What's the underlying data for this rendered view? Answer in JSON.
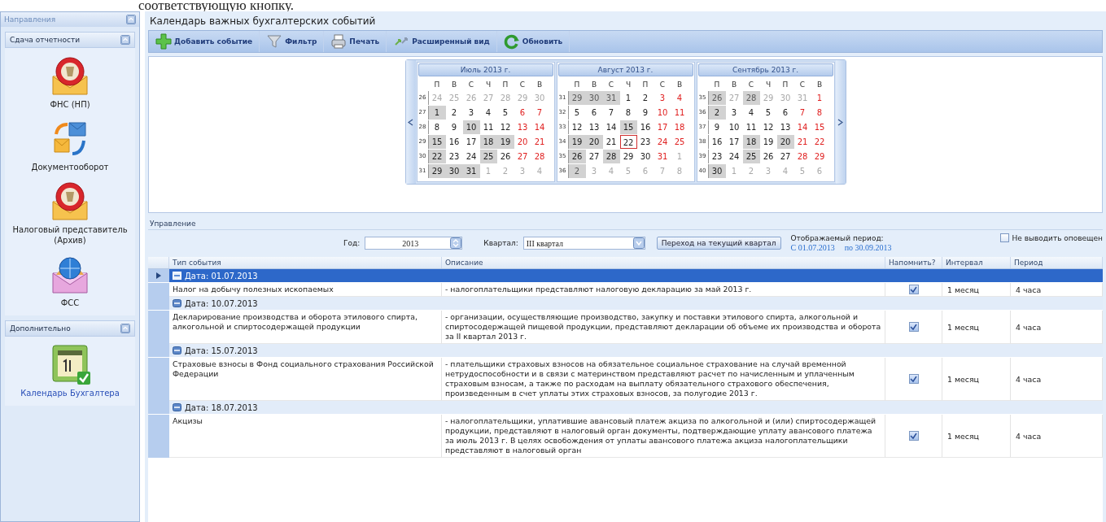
{
  "document_text": "соответствующую кнопку.",
  "sidebar": {
    "title": "Направления",
    "sections": [
      {
        "title": "Сдача отчетности",
        "items": [
          {
            "label": "ФНС (НП)",
            "kind": "tax",
            "selected": false
          },
          {
            "label": "Документооборот",
            "kind": "exchange",
            "selected": false
          },
          {
            "label": "Налоговый представитель (Архив)",
            "kind": "tax",
            "selected": false
          },
          {
            "label": "ФСС",
            "kind": "fss",
            "selected": false
          }
        ]
      },
      {
        "title": "Дополнительно",
        "items": [
          {
            "label": "Календарь Бухгалтера",
            "kind": "calendar",
            "selected": true
          }
        ]
      }
    ]
  },
  "page_title": "Календарь важных бухгалтерских событий",
  "toolbar": [
    {
      "label": "Добавить событие",
      "kind": "add"
    },
    {
      "label": "Фильтр",
      "kind": "filter"
    },
    {
      "label": "Печать",
      "kind": "print"
    },
    {
      "label": "Расширенный вид",
      "kind": "extended"
    },
    {
      "label": "Обновить",
      "kind": "refresh"
    }
  ],
  "calendars": [
    {
      "title": "Июль 2013 г.",
      "weekdays": [
        "П",
        "В",
        "С",
        "Ч",
        "П",
        "С",
        "В"
      ],
      "weeks": [
        {
          "number": "26",
          "days": [
            {
              "text": "24",
              "kind": "outside",
              "marked": false,
              "today": false
            },
            {
              "text": "25",
              "kind": "outside",
              "marked": false,
              "today": false
            },
            {
              "text": "26",
              "kind": "outside",
              "marked": false,
              "today": false
            },
            {
              "text": "27",
              "kind": "outside",
              "marked": false,
              "today": false
            },
            {
              "text": "28",
              "kind": "outside",
              "marked": false,
              "today": false
            },
            {
              "text": "29",
              "kind": "outside",
              "marked": false,
              "today": false
            },
            {
              "text": "30",
              "kind": "outside",
              "marked": false,
              "today": false
            }
          ]
        },
        {
          "number": "27",
          "days": [
            {
              "text": "1",
              "kind": "workday",
              "marked": true,
              "today": false
            },
            {
              "text": "2",
              "kind": "workday",
              "marked": false,
              "today": false
            },
            {
              "text": "3",
              "kind": "workday",
              "marked": false,
              "today": false
            },
            {
              "text": "4",
              "kind": "workday",
              "marked": false,
              "today": false
            },
            {
              "text": "5",
              "kind": "workday",
              "marked": false,
              "today": false
            },
            {
              "text": "6",
              "kind": "weekend",
              "marked": false,
              "today": false
            },
            {
              "text": "7",
              "kind": "weekend",
              "marked": false,
              "today": false
            }
          ]
        },
        {
          "number": "28",
          "days": [
            {
              "text": "8",
              "kind": "workday",
              "marked": false,
              "today": false
            },
            {
              "text": "9",
              "kind": "workday",
              "marked": false,
              "today": false
            },
            {
              "text": "10",
              "kind": "workday",
              "marked": true,
              "today": false
            },
            {
              "text": "11",
              "kind": "workday",
              "marked": false,
              "today": false
            },
            {
              "text": "12",
              "kind": "workday",
              "marked": false,
              "today": false
            },
            {
              "text": "13",
              "kind": "weekend",
              "marked": false,
              "today": false
            },
            {
              "text": "14",
              "kind": "weekend",
              "marked": false,
              "today": false
            }
          ]
        },
        {
          "number": "29",
          "days": [
            {
              "text": "15",
              "kind": "workday",
              "marked": true,
              "today": false
            },
            {
              "text": "16",
              "kind": "workday",
              "marked": false,
              "today": false
            },
            {
              "text": "17",
              "kind": "workday",
              "marked": false,
              "today": false
            },
            {
              "text": "18",
              "kind": "workday",
              "marked": true,
              "today": false
            },
            {
              "text": "19",
              "kind": "workday",
              "marked": true,
              "today": false
            },
            {
              "text": "20",
              "kind": "weekend",
              "marked": false,
              "today": false
            },
            {
              "text": "21",
              "kind": "weekend",
              "marked": false,
              "today": false
            }
          ]
        },
        {
          "number": "30",
          "days": [
            {
              "text": "22",
              "kind": "workday",
              "marked": true,
              "today": false
            },
            {
              "text": "23",
              "kind": "workday",
              "marked": false,
              "today": false
            },
            {
              "text": "24",
              "kind": "workday",
              "marked": false,
              "today": false
            },
            {
              "text": "25",
              "kind": "workday",
              "marked": true,
              "today": false
            },
            {
              "text": "26",
              "kind": "workday",
              "marked": false,
              "today": false
            },
            {
              "text": "27",
              "kind": "weekend",
              "marked": false,
              "today": false
            },
            {
              "text": "28",
              "kind": "weekend",
              "marked": false,
              "today": false
            }
          ]
        },
        {
          "number": "31",
          "days": [
            {
              "text": "29",
              "kind": "workday",
              "marked": true,
              "today": false
            },
            {
              "text": "30",
              "kind": "workday",
              "marked": true,
              "today": false
            },
            {
              "text": "31",
              "kind": "workday",
              "marked": true,
              "today": false
            },
            {
              "text": "1",
              "kind": "outside",
              "marked": false,
              "today": false
            },
            {
              "text": "2",
              "kind": "outside",
              "marked": false,
              "today": false
            },
            {
              "text": "3",
              "kind": "outside",
              "marked": false,
              "today": false
            },
            {
              "text": "4",
              "kind": "outside",
              "marked": false,
              "today": false
            }
          ]
        }
      ]
    },
    {
      "title": "Август 2013 г.",
      "weekdays": [
        "П",
        "В",
        "С",
        "Ч",
        "П",
        "С",
        "В"
      ],
      "weeks": [
        {
          "number": "31",
          "days": [
            {
              "text": "29",
              "kind": "outside",
              "marked": true,
              "today": false
            },
            {
              "text": "30",
              "kind": "outside",
              "marked": true,
              "today": false
            },
            {
              "text": "31",
              "kind": "outside",
              "marked": true,
              "today": false
            },
            {
              "text": "1",
              "kind": "workday",
              "marked": false,
              "today": false
            },
            {
              "text": "2",
              "kind": "workday",
              "marked": false,
              "today": false
            },
            {
              "text": "3",
              "kind": "weekend",
              "marked": false,
              "today": false
            },
            {
              "text": "4",
              "kind": "weekend",
              "marked": false,
              "today": false
            }
          ]
        },
        {
          "number": "32",
          "days": [
            {
              "text": "5",
              "kind": "workday",
              "marked": false,
              "today": false
            },
            {
              "text": "6",
              "kind": "workday",
              "marked": false,
              "today": false
            },
            {
              "text": "7",
              "kind": "workday",
              "marked": false,
              "today": false
            },
            {
              "text": "8",
              "kind": "workday",
              "marked": false,
              "today": false
            },
            {
              "text": "9",
              "kind": "workday",
              "marked": false,
              "today": false
            },
            {
              "text": "10",
              "kind": "weekend",
              "marked": false,
              "today": false
            },
            {
              "text": "11",
              "kind": "weekend",
              "marked": false,
              "today": false
            }
          ]
        },
        {
          "number": "33",
          "days": [
            {
              "text": "12",
              "kind": "workday",
              "marked": false,
              "today": false
            },
            {
              "text": "13",
              "kind": "workday",
              "marked": false,
              "today": false
            },
            {
              "text": "14",
              "kind": "workday",
              "marked": false,
              "today": false
            },
            {
              "text": "15",
              "kind": "workday",
              "marked": true,
              "today": false
            },
            {
              "text": "16",
              "kind": "workday",
              "marked": false,
              "today": false
            },
            {
              "text": "17",
              "kind": "weekend",
              "marked": false,
              "today": false
            },
            {
              "text": "18",
              "kind": "weekend",
              "marked": false,
              "today": false
            }
          ]
        },
        {
          "number": "34",
          "days": [
            {
              "text": "19",
              "kind": "workday",
              "marked": true,
              "today": false
            },
            {
              "text": "20",
              "kind": "workday",
              "marked": true,
              "today": false
            },
            {
              "text": "21",
              "kind": "workday",
              "marked": false,
              "today": false
            },
            {
              "text": "22",
              "kind": "workday",
              "marked": false,
              "today": true
            },
            {
              "text": "23",
              "kind": "workday",
              "marked": false,
              "today": false
            },
            {
              "text": "24",
              "kind": "weekend",
              "marked": false,
              "today": false
            },
            {
              "text": "25",
              "kind": "weekend",
              "marked": false,
              "today": false
            }
          ]
        },
        {
          "number": "35",
          "days": [
            {
              "text": "26",
              "kind": "workday",
              "marked": true,
              "today": false
            },
            {
              "text": "27",
              "kind": "workday",
              "marked": false,
              "today": false
            },
            {
              "text": "28",
              "kind": "workday",
              "marked": true,
              "today": false
            },
            {
              "text": "29",
              "kind": "workday",
              "marked": false,
              "today": false
            },
            {
              "text": "30",
              "kind": "workday",
              "marked": false,
              "today": false
            },
            {
              "text": "31",
              "kind": "weekend",
              "marked": false,
              "today": false
            },
            {
              "text": "1",
              "kind": "outside",
              "marked": false,
              "today": false
            }
          ]
        },
        {
          "number": "36",
          "days": [
            {
              "text": "2",
              "kind": "outside",
              "marked": true,
              "today": false
            },
            {
              "text": "3",
              "kind": "outside",
              "marked": false,
              "today": false
            },
            {
              "text": "4",
              "kind": "outside",
              "marked": false,
              "today": false
            },
            {
              "text": "5",
              "kind": "outside",
              "marked": false,
              "today": false
            },
            {
              "text": "6",
              "kind": "outside",
              "marked": false,
              "today": false
            },
            {
              "text": "7",
              "kind": "outside",
              "marked": false,
              "today": false
            },
            {
              "text": "8",
              "kind": "outside",
              "marked": false,
              "today": false
            }
          ]
        }
      ]
    },
    {
      "title": "Сентябрь 2013 г.",
      "weekdays": [
        "П",
        "В",
        "С",
        "Ч",
        "П",
        "С",
        "В"
      ],
      "weeks": [
        {
          "number": "35",
          "days": [
            {
              "text": "26",
              "kind": "outside",
              "marked": true,
              "today": false
            },
            {
              "text": "27",
              "kind": "outside",
              "marked": false,
              "today": false
            },
            {
              "text": "28",
              "kind": "outside",
              "marked": true,
              "today": false
            },
            {
              "text": "29",
              "kind": "outside",
              "marked": false,
              "today": false
            },
            {
              "text": "30",
              "kind": "outside",
              "marked": false,
              "today": false
            },
            {
              "text": "31",
              "kind": "outside",
              "marked": false,
              "today": false
            },
            {
              "text": "1",
              "kind": "weekend",
              "marked": false,
              "today": false
            }
          ]
        },
        {
          "number": "36",
          "days": [
            {
              "text": "2",
              "kind": "workday",
              "marked": true,
              "today": false
            },
            {
              "text": "3",
              "kind": "workday",
              "marked": false,
              "today": false
            },
            {
              "text": "4",
              "kind": "workday",
              "marked": false,
              "today": false
            },
            {
              "text": "5",
              "kind": "workday",
              "marked": false,
              "today": false
            },
            {
              "text": "6",
              "kind": "workday",
              "marked": false,
              "today": false
            },
            {
              "text": "7",
              "kind": "weekend",
              "marked": false,
              "today": false
            },
            {
              "text": "8",
              "kind": "weekend",
              "marked": false,
              "today": false
            }
          ]
        },
        {
          "number": "37",
          "days": [
            {
              "text": "9",
              "kind": "workday",
              "marked": false,
              "today": false
            },
            {
              "text": "10",
              "kind": "workday",
              "marked": false,
              "today": false
            },
            {
              "text": "11",
              "kind": "workday",
              "marked": false,
              "today": false
            },
            {
              "text": "12",
              "kind": "workday",
              "marked": false,
              "today": false
            },
            {
              "text": "13",
              "kind": "workday",
              "marked": false,
              "today": false
            },
            {
              "text": "14",
              "kind": "weekend",
              "marked": false,
              "today": false
            },
            {
              "text": "15",
              "kind": "weekend",
              "marked": false,
              "today": false
            }
          ]
        },
        {
          "number": "38",
          "days": [
            {
              "text": "16",
              "kind": "workday",
              "marked": false,
              "today": false
            },
            {
              "text": "17",
              "kind": "workday",
              "marked": false,
              "today": false
            },
            {
              "text": "18",
              "kind": "workday",
              "marked": true,
              "today": false
            },
            {
              "text": "19",
              "kind": "workday",
              "marked": false,
              "today": false
            },
            {
              "text": "20",
              "kind": "workday",
              "marked": true,
              "today": false
            },
            {
              "text": "21",
              "kind": "weekend",
              "marked": false,
              "today": false
            },
            {
              "text": "22",
              "kind": "weekend",
              "marked": false,
              "today": false
            }
          ]
        },
        {
          "number": "39",
          "days": [
            {
              "text": "23",
              "kind": "workday",
              "marked": false,
              "today": false
            },
            {
              "text": "24",
              "kind": "workday",
              "marked": false,
              "today": false
            },
            {
              "text": "25",
              "kind": "workday",
              "marked": true,
              "today": false
            },
            {
              "text": "26",
              "kind": "workday",
              "marked": false,
              "today": false
            },
            {
              "text": "27",
              "kind": "workday",
              "marked": false,
              "today": false
            },
            {
              "text": "28",
              "kind": "weekend",
              "marked": false,
              "today": false
            },
            {
              "text": "29",
              "kind": "weekend",
              "marked": false,
              "today": false
            }
          ]
        },
        {
          "number": "40",
          "days": [
            {
              "text": "30",
              "kind": "workday",
              "marked": true,
              "today": false
            },
            {
              "text": "1",
              "kind": "outside",
              "marked": false,
              "today": false
            },
            {
              "text": "2",
              "kind": "outside",
              "marked": false,
              "today": false
            },
            {
              "text": "3",
              "kind": "outside",
              "marked": false,
              "today": false
            },
            {
              "text": "4",
              "kind": "outside",
              "marked": false,
              "today": false
            },
            {
              "text": "5",
              "kind": "outside",
              "marked": false,
              "today": false
            },
            {
              "text": "6",
              "kind": "outside",
              "marked": false,
              "today": false
            }
          ]
        }
      ]
    }
  ],
  "control_panel": {
    "title": "Управление",
    "year_label": "Год:",
    "year": "2013",
    "quarter_label": "Квартал:",
    "quarter": "III квартал",
    "current_quarter_button": "Переход на текущий квартал",
    "period_label": "Отображаемый период:",
    "period_from": "С 01.07.2013",
    "period_to": "по 30.09.2013",
    "hide_notifications": {
      "label": "Не выводить оповещен",
      "checked": false
    }
  },
  "table": {
    "columns": [
      "Тип события",
      "Описание",
      "Напомнить?",
      "Интервал",
      "Период"
    ],
    "groups": [
      {
        "label": "Дата: 01.07.2013",
        "selected": true,
        "rows": [
          {
            "type": "Налог на добычу полезных ископаемых",
            "description": "- налогоплательщики представляют налоговую декларацию за май 2013 г.",
            "remind": true,
            "interval": "1 месяц",
            "period": "4 часа"
          }
        ]
      },
      {
        "label": "Дата: 10.07.2013",
        "selected": false,
        "rows": [
          {
            "type": "Декларирование производства и оборота этилового спирта, алкогольной и спиртосодержащей продукции",
            "description": "- организации, осуществляющие производство, закупку и поставки этилового спирта, алкогольной и спиртосодержащей пищевой продукции, представляют декларации об объеме их производства и оборота за II квартал 2013 г.",
            "remind": true,
            "interval": "1 месяц",
            "period": "4 часа"
          }
        ]
      },
      {
        "label": "Дата: 15.07.2013",
        "selected": false,
        "rows": [
          {
            "type": "Страховые взносы в Фонд социального страхования Российской Федерации",
            "description": "- плательщики страховых взносов на обязательное социальное страхование на случай временной нетрудоспособности и в связи с материнством представляют расчет по начисленным и уплаченным страховым взносам, а также по расходам на выплату обязательного страхового обеспечения, произведенным в счет уплаты этих страховых взносов, за полугодие 2013 г.",
            "remind": true,
            "interval": "1 месяц",
            "period": "4 часа"
          }
        ]
      },
      {
        "label": "Дата: 18.07.2013",
        "selected": false,
        "rows": [
          {
            "type": "Акцизы",
            "description": "- налогоплательщики, уплатившие авансовый платеж акциза по алкогольной и (или) спиртосодержащей продукции, представляют в налоговый орган документы, подтверждающие уплату авансового платежа за июль 2013 г. В целях освобождения от уплаты авансового платежа акциза налогоплательщики представляют в налоговый орган",
            "remind": true,
            "interval": "1 месяц",
            "period": "4 часа"
          }
        ]
      }
    ]
  }
}
